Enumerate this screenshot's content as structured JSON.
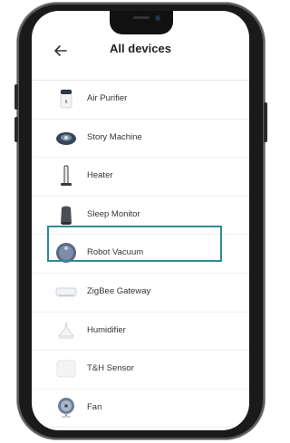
{
  "header": {
    "title": "All devices",
    "back_icon": "arrow-left-icon"
  },
  "devices": [
    {
      "label": "Air Purifier",
      "icon": "air-purifier-icon"
    },
    {
      "label": "Story Machine",
      "icon": "story-machine-icon"
    },
    {
      "label": "Heater",
      "icon": "heater-icon"
    },
    {
      "label": "Sleep Monitor",
      "icon": "sleep-monitor-icon"
    },
    {
      "label": "Robot Vacuum",
      "icon": "robot-vacuum-icon",
      "selected": true
    },
    {
      "label": "ZigBee Gateway",
      "icon": "zigbee-gateway-icon"
    },
    {
      "label": "Humidifier",
      "icon": "humidifier-icon"
    },
    {
      "label": "T&H Sensor",
      "icon": "th-sensor-icon"
    },
    {
      "label": "Fan",
      "icon": "fan-icon"
    }
  ],
  "colors": {
    "highlight": "#2e8b9a"
  }
}
